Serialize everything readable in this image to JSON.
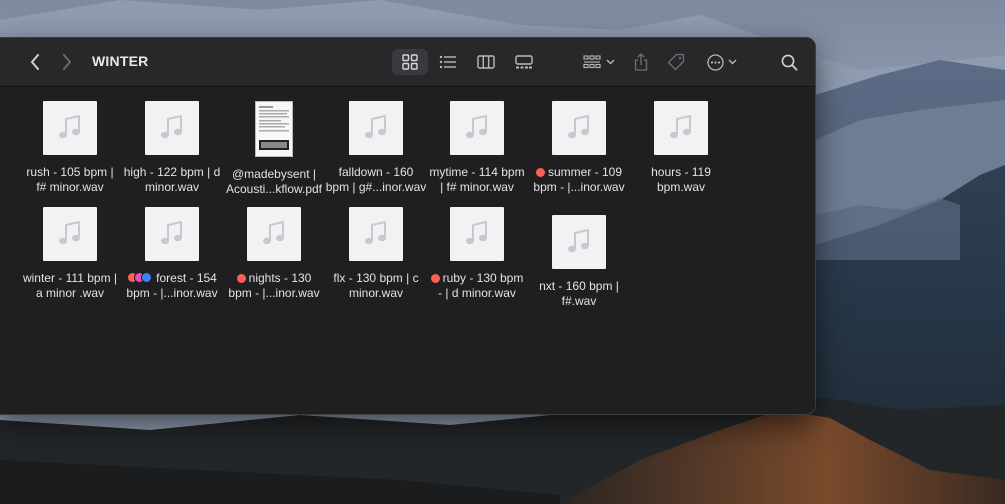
{
  "window": {
    "title": "WINTER",
    "toolbar": {
      "back_icon": "chevron-left-icon",
      "forward_icon": "chevron-right-icon",
      "views": [
        "icon-view",
        "list-view",
        "column-view",
        "gallery-view"
      ],
      "group_icon": "group-icon",
      "share_icon": "share-icon",
      "tag_icon": "tag-icon",
      "more_icon": "ellipsis-circle-icon",
      "search_icon": "search-icon"
    }
  },
  "files": [
    {
      "line1": "rush - 105 bpm |",
      "line2": "f# minor.wav",
      "type": "audio",
      "tags": []
    },
    {
      "line1": "high - 122 bpm | d",
      "line2": "minor.wav",
      "type": "audio",
      "tags": []
    },
    {
      "line1": "@madebysent |",
      "line2": "Acousti...kflow.pdf",
      "type": "pdf",
      "tags": []
    },
    {
      "line1": "falldown - 160",
      "line2": "bpm | g#...inor.wav",
      "type": "audio",
      "tags": []
    },
    {
      "line1": "mytime - 114 bpm",
      "line2": "| f# minor.wav",
      "type": "audio",
      "tags": []
    },
    {
      "line1": "summer - 109",
      "line2": "bpm -  |...inor.wav",
      "type": "audio",
      "tags": [
        "#ff5f57"
      ]
    },
    {
      "line1": "hours - 119",
      "line2": "bpm.wav",
      "type": "audio",
      "tags": []
    },
    {
      "line1": "winter - 111 bpm |",
      "line2": "a minor .wav",
      "type": "audio",
      "tags": []
    },
    {
      "line1": "forest - 154",
      "line2": "bpm -  |...inor.wav",
      "type": "audio",
      "tags": [
        "#ff5f57",
        "#e64db7",
        "#3b82f6"
      ]
    },
    {
      "line1": "nights - 130",
      "line2": "bpm -  |...inor.wav",
      "type": "audio",
      "tags": [
        "#ff5f57"
      ]
    },
    {
      "line1": "flx - 130 bpm | c",
      "line2": "minor.wav",
      "type": "audio",
      "tags": []
    },
    {
      "line1": "ruby - 130 bpm",
      "line2": "-  | d minor.wav",
      "type": "audio",
      "tags": [
        "#ff5f57"
      ]
    },
    {
      "line1": "nxt - 160 bpm |",
      "line2": "f#.wav",
      "type": "audio",
      "tags": []
    }
  ],
  "colors": {
    "window_bg": "#1f1f22",
    "toolbar_bg": "#28282b",
    "text": "#e3e3e6",
    "tag_red": "#ff5f57"
  }
}
